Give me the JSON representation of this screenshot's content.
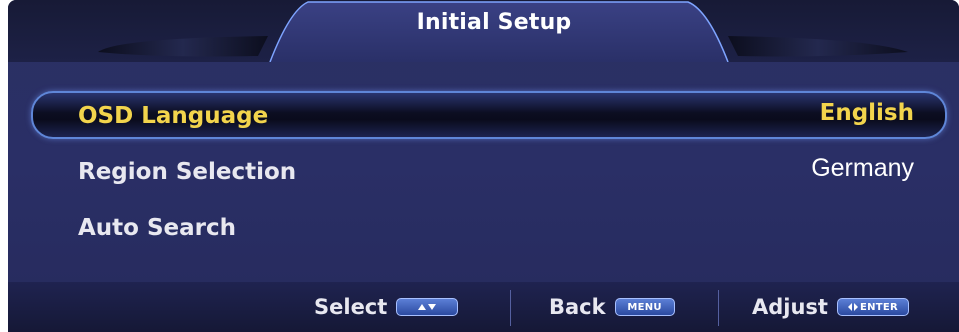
{
  "window": {
    "title": "Initial Setup"
  },
  "menu": {
    "items": [
      {
        "label": "OSD Language",
        "value": "English",
        "selected": true
      },
      {
        "label": "Region Selection",
        "value": "Germany",
        "selected": false
      },
      {
        "label": "Auto Search",
        "value": "",
        "selected": false
      }
    ]
  },
  "footer": {
    "select_label": "Select",
    "select_key_icon": "up-down-arrows-icon",
    "back_label": "Back",
    "back_key": "MENU",
    "adjust_label": "Adjust",
    "adjust_key": "ENTER",
    "adjust_key_icon": "left-right-arrows-icon"
  },
  "colors": {
    "background": "#2a2f66",
    "header": "#171a36",
    "highlight_border": "#5f86d8",
    "selected_text": "#f2d44c",
    "text": "#e8e8f0"
  }
}
